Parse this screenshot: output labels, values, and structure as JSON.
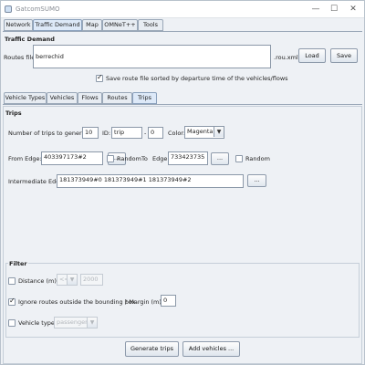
{
  "window": {
    "title": "GatcomSUMO",
    "minimize": "—",
    "maximize": "☐",
    "close": "✕"
  },
  "main_tabs": [
    "Network",
    "Traffic Demand",
    "Map",
    "OMNeT++",
    "Tools"
  ],
  "traffic_demand": {
    "heading": "Traffic Demand",
    "routes_file_label": "Routes file:",
    "routes_file_value": "berrechid",
    "routes_ext": ".rou.xml",
    "load_label": "Load",
    "save_label": "Save",
    "sort_label": "Save route file sorted by departure time of the vehicles/flows"
  },
  "sub_tabs": [
    "Vehicle Types",
    "Vehicles",
    "Flows",
    "Routes",
    "Trips"
  ],
  "trips": {
    "heading": "Trips",
    "num_label": "Number of trips to generate:",
    "num_value": "10",
    "id_label": "ID:",
    "id_value": "trip",
    "dash": "-",
    "id_suffix": "0",
    "color_label": "Color:",
    "color_value": "Magenta",
    "from_label": "From Edge:",
    "from_value": "403397173#2",
    "browse": "...",
    "random_label": "Random",
    "to_label": "To",
    "to_edge_label": "Edge:",
    "to_value": "733423735",
    "intermediate_label": "Intermediate Edges:",
    "intermediate_value": "181373949#0 181373949#1 181373949#2"
  },
  "filter": {
    "heading": "Filter",
    "distance_label": "Distance (m):",
    "distance_op": "<=",
    "distance_value": "2000",
    "bbox_label": "Ignore routes outside the bounding box",
    "margin_label": "/ Margin (m):",
    "margin_value": "0",
    "vtype_label": "Vehicle type",
    "vtype_value": "passenger"
  },
  "footer": {
    "generate_label": "Generate trips",
    "add_label": "Add vehicles ..."
  }
}
